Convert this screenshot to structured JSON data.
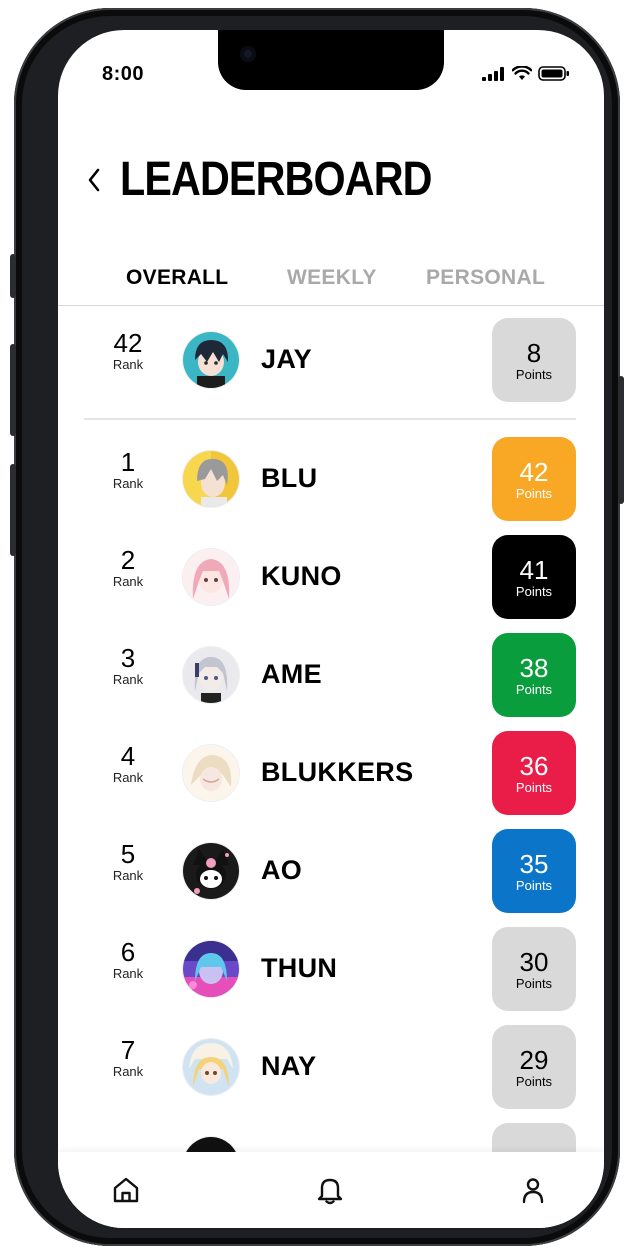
{
  "status_bar": {
    "time": "8:00",
    "icons": [
      "signal-icon",
      "wifi-icon",
      "battery-icon"
    ]
  },
  "header": {
    "back_icon": "chevron-left-icon",
    "title": "LEADERBOARD"
  },
  "tabs": [
    {
      "label": "OVERALL",
      "active": true
    },
    {
      "label": "WEEKLY",
      "active": false
    },
    {
      "label": "PERSONAL",
      "active": false
    }
  ],
  "current_user": {
    "rank": "42",
    "rank_label": "Rank",
    "name": "JAY",
    "points": "8",
    "points_label": "Points",
    "badge_color": "#d9d9d9",
    "text_color": "#000000"
  },
  "leaderboard": [
    {
      "rank": "1",
      "rank_label": "Rank",
      "name": "BLU",
      "points": "42",
      "points_label": "Points",
      "badge_color": "#f9a825",
      "text_color": "#ffffff"
    },
    {
      "rank": "2",
      "rank_label": "Rank",
      "name": "KUNO",
      "points": "41",
      "points_label": "Points",
      "badge_color": "#000000",
      "text_color": "#ffffff"
    },
    {
      "rank": "3",
      "rank_label": "Rank",
      "name": "AME",
      "points": "38",
      "points_label": "Points",
      "badge_color": "#0a9d3e",
      "text_color": "#ffffff"
    },
    {
      "rank": "4",
      "rank_label": "Rank",
      "name": "BLUKKERS",
      "points": "36",
      "points_label": "Points",
      "badge_color": "#ea1d48",
      "text_color": "#ffffff"
    },
    {
      "rank": "5",
      "rank_label": "Rank",
      "name": "AO",
      "points": "35",
      "points_label": "Points",
      "badge_color": "#0b76c9",
      "text_color": "#ffffff"
    },
    {
      "rank": "6",
      "rank_label": "Rank",
      "name": "THUN",
      "points": "30",
      "points_label": "Points",
      "badge_color": "#d9d9d9",
      "text_color": "#000000"
    },
    {
      "rank": "7",
      "rank_label": "Rank",
      "name": "NAY",
      "points": "29",
      "points_label": "Points",
      "badge_color": "#d9d9d9",
      "text_color": "#000000"
    }
  ],
  "bottom_nav": [
    {
      "icon": "home-icon"
    },
    {
      "icon": "bell-icon"
    },
    {
      "icon": "profile-icon"
    }
  ]
}
